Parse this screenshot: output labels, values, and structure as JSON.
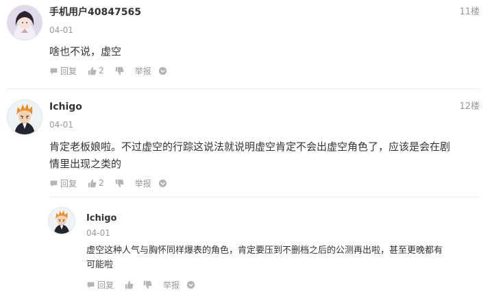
{
  "comments": [
    {
      "username": "手机用户40847565",
      "date": "04-01",
      "floor": "11楼",
      "text": "啥也不说，虚空",
      "reply_label": "回复",
      "like_count": "2",
      "report_label": "举报"
    },
    {
      "username": "Ichigo",
      "date": "04-01",
      "floor": "12楼",
      "text_line1": "肯定老板娘啦。不过虚空的行踪这说法就说明虚空肯定不会出虚空角色了，应该是会在剧",
      "text_line2": "情里出现之类的",
      "reply_label": "回复",
      "like_count": "2",
      "report_label": "举报",
      "sub_reply": {
        "username": "Ichigo",
        "date": "04-01",
        "text_line1": "虚空这种人气与胸怀同样爆表的角色，肯定要压到不删档之后的公测再出啦，甚至更晚都有",
        "text_line2": "可能啦",
        "reply_label": "回复",
        "report_label": "举报"
      }
    }
  ],
  "colors": {
    "meta_text": "#999999",
    "divider": "#ebebeb",
    "body_text": "#333333"
  }
}
